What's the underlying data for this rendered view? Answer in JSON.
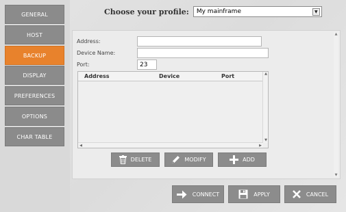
{
  "sidebar": {
    "items": [
      {
        "label": "GENERAL"
      },
      {
        "label": "HOST"
      },
      {
        "label": "BACKUP"
      },
      {
        "label": "DISPLAY"
      },
      {
        "label": "PREFERENCES"
      },
      {
        "label": "OPTIONS"
      },
      {
        "label": "CHAR TABLE"
      }
    ],
    "active": "BACKUP"
  },
  "profile": {
    "label": "Choose your profile:",
    "selected": "My mainframe"
  },
  "form": {
    "address_label": "Address:",
    "address_value": "",
    "device_label": "Device Name:",
    "device_value": "",
    "port_label": "Port:",
    "port_value": "23"
  },
  "table": {
    "columns": [
      "Address",
      "Device",
      "Port"
    ],
    "rows": []
  },
  "actions": {
    "delete": "DELETE",
    "modify": "MODIFY",
    "add": "ADD"
  },
  "footer": {
    "connect": "CONNECT",
    "apply": "APPLY",
    "cancel": "CANCEL"
  },
  "colors": {
    "accent": "#e8822c",
    "button": "#8b8b8b"
  }
}
